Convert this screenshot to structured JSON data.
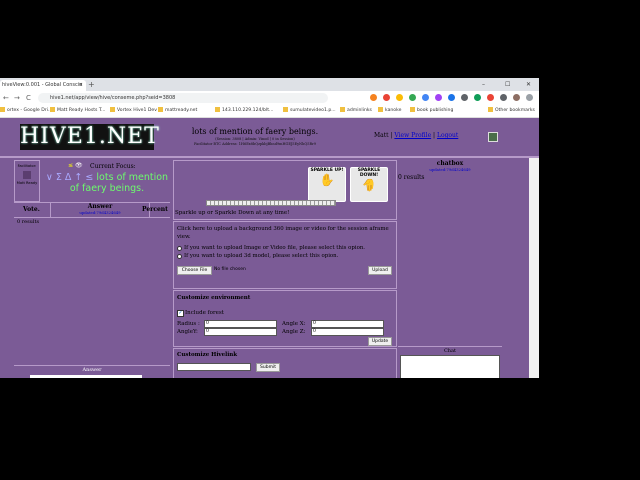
{
  "browser": {
    "tab_title": "hiveView:0.001 - Global Conscio",
    "tab_close": "×",
    "new_tab": "+",
    "url": "hive1.net/app/view/hive/conseme.php?seid=3808",
    "window_controls": {
      "minimize": "–",
      "maximize": "☐",
      "close": "✕"
    },
    "nav": {
      "back": "←",
      "forward": "→",
      "reload": "C"
    },
    "bookmarks": [
      "ortex - Google Dri...",
      "Matt Ready Hosts T...",
      "Vortex Hive1 Dev",
      "mattready.net",
      "143.110.229.124/blt...",
      "sumulatevideo1.p...",
      "adminlinks",
      "kanoke",
      "book publishing",
      "Other bookmarks"
    ]
  },
  "header": {
    "logo": "HIVE1.NET",
    "hive_title": "lots of mention of faery beings.",
    "session_line": "(Session: 3808 | Admin: Vinod | 0 in Session)",
    "address_line": "Facilitator BTC Address: 1H6Ex8bQzpkbjBhnd9mHGEJ5EyNhQ5Rr9",
    "user": "Matt",
    "separator1": " | ",
    "view_profile": "View Profile",
    "separator2": " | ",
    "logout": "Logout"
  },
  "left": {
    "facilitator_label": "Facilitator:",
    "facilitator_name": "Matt Ready",
    "eye_symbols": "≤",
    "current_focus_label": "Current Focus:",
    "focus_symbols": "∨ Σ Δ ↑ ≤",
    "focus_text": "lots of mention of faery beings.",
    "vote_label": "Vote.",
    "answer_label": "Answer",
    "answer_updated": "updated:79d4324649",
    "percent_label": "Percent",
    "results": "0 results",
    "answer_footer": "Answer"
  },
  "middle": {
    "sparkle_up": "SPARKLE UP!",
    "sparkle_down": "SPARKLE DOWN!",
    "sparkle_up_hand": "✋",
    "sparkle_down_hand": "✋",
    "sparkle_text": "Sparkle up or Sparkle Down at any time!",
    "bg_text": "Click here to upload a background 360 image or video for the session aframe view.",
    "radio1": "If you want to upload Image or Video file, please select this opion.",
    "radio2": "If you want to upload 3d model, please select this opion.",
    "choose_file": "Choose File",
    "no_file": "No file chosen",
    "upload": "Upload",
    "customize_env": "Customize environment",
    "include_forest": "Include forest",
    "checkmark": "✓",
    "radius_label": "Radius :",
    "radius_value": "0",
    "angle_x_label": "Angle X:",
    "angle_x_value": "0",
    "angle_y_label": "AngleY:",
    "angle_y_value": "0",
    "angle_z_label": "Angle Z:",
    "angle_z_value": "0",
    "update": "Update",
    "customize_hivelink": "Customize Hivelink",
    "submit": "Submit"
  },
  "right": {
    "chatbox": "chatbox",
    "chat_updated": "updated:79d4324649",
    "results": "0 results",
    "chat_label": "Chat"
  }
}
